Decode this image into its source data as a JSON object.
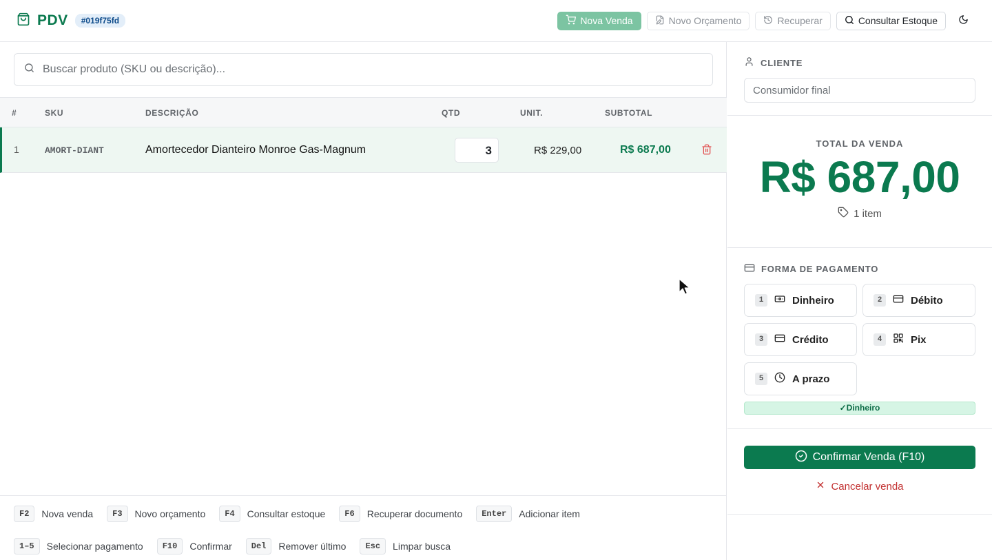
{
  "header": {
    "app_title": "PDV",
    "doc_id": "#019f75fd",
    "actions": {
      "nova_venda": "Nova Venda",
      "novo_orcamento": "Novo Orçamento",
      "recuperar": "Recuperar",
      "consultar_estoque": "Consultar Estoque"
    },
    "icons": {
      "brand": "shopping-bag-icon",
      "theme": "moon-icon"
    }
  },
  "search": {
    "placeholder": "Buscar produto (SKU ou descrição)..."
  },
  "table": {
    "columns": [
      "#",
      "SKU",
      "DESCRIÇÃO",
      "QTD",
      "UNIT.",
      "SUBTOTAL"
    ],
    "rows": [
      {
        "index": "1",
        "sku": "AMORT-DIANT",
        "description": "Amortecedor Dianteiro Monroe Gas-Magnum",
        "qty": "3",
        "unit": "R$ 229,00",
        "subtotal": "R$ 687,00"
      }
    ]
  },
  "shortcuts": [
    {
      "key": "F2",
      "label": "Nova venda"
    },
    {
      "key": "F3",
      "label": "Novo orçamento"
    },
    {
      "key": "F4",
      "label": "Consultar estoque"
    },
    {
      "key": "F6",
      "label": "Recuperar documento"
    },
    {
      "key": "Enter",
      "label": "Adicionar item"
    },
    {
      "key": "1–5",
      "label": "Selecionar pagamento"
    },
    {
      "key": "F10",
      "label": "Confirmar"
    },
    {
      "key": "Del",
      "label": "Remover último"
    },
    {
      "key": "Esc",
      "label": "Limpar busca"
    }
  ],
  "sidebar": {
    "cliente": {
      "title": "CLIENTE",
      "placeholder": "Consumidor final"
    },
    "total": {
      "label": "TOTAL DA VENDA",
      "value": "R$ 687,00",
      "item_count": "1 item"
    },
    "payment": {
      "title": "FORMA DE PAGAMENTO",
      "options": [
        {
          "key": "1",
          "label": "Dinheiro",
          "icon": "banknote-icon"
        },
        {
          "key": "2",
          "label": "Débito",
          "icon": "credit-card-icon"
        },
        {
          "key": "3",
          "label": "Crédito",
          "icon": "credit-card-icon"
        },
        {
          "key": "4",
          "label": "Pix",
          "icon": "qr-code-icon"
        },
        {
          "key": "5",
          "label": "A prazo",
          "icon": "clock-icon"
        }
      ],
      "selected": "✓Dinheiro"
    },
    "confirm_label": "Confirmar Venda (F10)",
    "cancel_label": "Cancelar venda"
  },
  "colors": {
    "brand_green": "#0b7a4f",
    "danger_red": "#c22f2f"
  }
}
